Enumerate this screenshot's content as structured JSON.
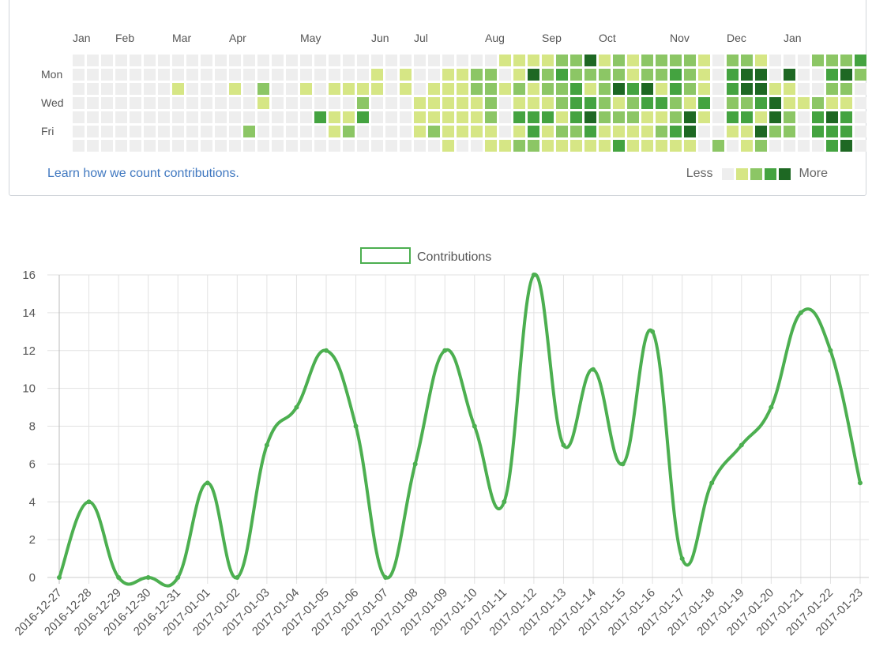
{
  "calendar": {
    "months": [
      {
        "label": "Jan",
        "week": 0
      },
      {
        "label": "Feb",
        "week": 3
      },
      {
        "label": "Mar",
        "week": 7
      },
      {
        "label": "Apr",
        "week": 11
      },
      {
        "label": "May",
        "week": 16
      },
      {
        "label": "Jun",
        "week": 21
      },
      {
        "label": "Jul",
        "week": 24
      },
      {
        "label": "Aug",
        "week": 29
      },
      {
        "label": "Sep",
        "week": 33
      },
      {
        "label": "Oct",
        "week": 37
      },
      {
        "label": "Nov",
        "week": 42
      },
      {
        "label": "Dec",
        "week": 46
      },
      {
        "label": "Jan",
        "week": 50
      }
    ],
    "days": [
      {
        "label": "Mon",
        "row": 1
      },
      {
        "label": "Wed",
        "row": 3
      },
      {
        "label": "Fri",
        "row": 5
      }
    ],
    "colors": [
      "#eeeeee",
      "#d6e685",
      "#8cc665",
      "#44a340",
      "#1e6823"
    ],
    "weeks": [
      [
        0,
        0,
        0,
        0,
        0,
        0,
        0
      ],
      [
        0,
        0,
        0,
        0,
        0,
        0,
        0
      ],
      [
        0,
        0,
        0,
        0,
        0,
        0,
        0
      ],
      [
        0,
        0,
        0,
        0,
        0,
        0,
        0
      ],
      [
        0,
        0,
        0,
        0,
        0,
        0,
        0
      ],
      [
        0,
        0,
        0,
        0,
        0,
        0,
        0
      ],
      [
        0,
        0,
        0,
        0,
        0,
        0,
        0
      ],
      [
        0,
        0,
        1,
        0,
        0,
        0,
        0
      ],
      [
        0,
        0,
        0,
        0,
        0,
        0,
        0
      ],
      [
        0,
        0,
        0,
        0,
        0,
        0,
        0
      ],
      [
        0,
        0,
        0,
        0,
        0,
        0,
        0
      ],
      [
        0,
        0,
        1,
        0,
        0,
        0,
        0
      ],
      [
        0,
        0,
        0,
        0,
        0,
        2,
        0
      ],
      [
        0,
        0,
        2,
        1,
        0,
        0,
        0
      ],
      [
        0,
        0,
        0,
        0,
        0,
        0,
        0
      ],
      [
        0,
        0,
        0,
        0,
        0,
        0,
        0
      ],
      [
        0,
        0,
        1,
        0,
        0,
        0,
        0
      ],
      [
        0,
        0,
        0,
        0,
        3,
        0,
        0
      ],
      [
        0,
        0,
        1,
        0,
        1,
        1,
        0
      ],
      [
        0,
        0,
        1,
        0,
        1,
        2,
        0
      ],
      [
        0,
        0,
        1,
        2,
        3,
        0,
        0
      ],
      [
        0,
        1,
        1,
        0,
        0,
        0,
        0
      ],
      [
        0,
        0,
        0,
        0,
        0,
        0,
        0
      ],
      [
        0,
        1,
        1,
        0,
        0,
        0,
        0
      ],
      [
        0,
        0,
        0,
        1,
        1,
        1,
        0
      ],
      [
        0,
        0,
        1,
        1,
        1,
        2,
        0
      ],
      [
        0,
        1,
        1,
        1,
        1,
        1,
        1
      ],
      [
        0,
        1,
        1,
        1,
        1,
        1,
        0
      ],
      [
        0,
        2,
        2,
        1,
        1,
        1,
        0
      ],
      [
        0,
        2,
        2,
        2,
        2,
        1,
        1
      ],
      [
        1,
        0,
        1,
        0,
        0,
        0,
        1
      ],
      [
        1,
        1,
        2,
        1,
        3,
        1,
        2
      ],
      [
        1,
        4,
        1,
        1,
        3,
        3,
        2
      ],
      [
        1,
        2,
        2,
        1,
        3,
        1,
        1
      ],
      [
        2,
        3,
        2,
        2,
        1,
        2,
        1
      ],
      [
        2,
        2,
        3,
        3,
        3,
        2,
        1
      ],
      [
        4,
        2,
        1,
        3,
        4,
        3,
        1
      ],
      [
        1,
        2,
        2,
        2,
        2,
        1,
        1
      ],
      [
        2,
        2,
        4,
        1,
        2,
        1,
        3
      ],
      [
        1,
        1,
        3,
        2,
        2,
        1,
        1
      ],
      [
        2,
        2,
        4,
        3,
        1,
        1,
        1
      ],
      [
        2,
        2,
        1,
        3,
        1,
        2,
        1
      ],
      [
        2,
        3,
        3,
        2,
        2,
        3,
        1
      ],
      [
        2,
        2,
        2,
        1,
        4,
        4,
        1
      ],
      [
        1,
        1,
        1,
        3,
        1,
        0,
        0
      ],
      [
        0,
        0,
        0,
        0,
        0,
        0,
        2
      ],
      [
        2,
        3,
        3,
        2,
        3,
        1,
        0
      ],
      [
        2,
        4,
        4,
        2,
        3,
        1,
        1
      ],
      [
        1,
        4,
        4,
        3,
        1,
        4,
        2
      ],
      [
        0,
        0,
        1,
        4,
        4,
        2,
        0
      ],
      [
        0,
        4,
        1,
        1,
        2,
        2,
        0
      ],
      [
        0,
        0,
        0,
        1,
        0,
        0,
        0
      ],
      [
        2,
        0,
        0,
        2,
        3,
        3,
        0
      ],
      [
        2,
        3,
        2,
        1,
        4,
        3,
        3
      ],
      [
        2,
        4,
        2,
        1,
        3,
        3,
        4
      ],
      [
        3,
        2,
        0,
        0,
        0,
        0,
        0
      ]
    ],
    "learn_link": "Learn how we count contributions.",
    "legend_less": "Less",
    "legend_more": "More"
  },
  "chart_data": {
    "type": "line",
    "x": [
      "2016-12-27",
      "2016-12-28",
      "2016-12-29",
      "2016-12-30",
      "2016-12-31",
      "2017-01-01",
      "2017-01-02",
      "2017-01-03",
      "2017-01-04",
      "2017-01-05",
      "2017-01-06",
      "2017-01-07",
      "2017-01-08",
      "2017-01-09",
      "2017-01-10",
      "2017-01-11",
      "2017-01-12",
      "2017-01-13",
      "2017-01-14",
      "2017-01-15",
      "2017-01-16",
      "2017-01-17",
      "2017-01-18",
      "2017-01-19",
      "2017-01-20",
      "2017-01-21",
      "2017-01-22",
      "2017-01-23"
    ],
    "series": [
      {
        "name": "Contributions",
        "color": "#4caf50",
        "values": [
          0,
          4,
          0,
          0,
          0,
          5,
          0,
          7,
          9,
          12,
          8,
          0,
          6,
          12,
          8,
          4,
          16,
          7,
          11,
          6,
          13,
          1,
          5,
          7,
          9,
          14,
          12,
          5
        ]
      }
    ],
    "ylim": [
      0,
      16
    ],
    "yticks": [
      0,
      2,
      4,
      6,
      8,
      10,
      12,
      14,
      16
    ],
    "grid": true,
    "legend_position": "top",
    "title": "",
    "xlabel": "",
    "ylabel": ""
  }
}
